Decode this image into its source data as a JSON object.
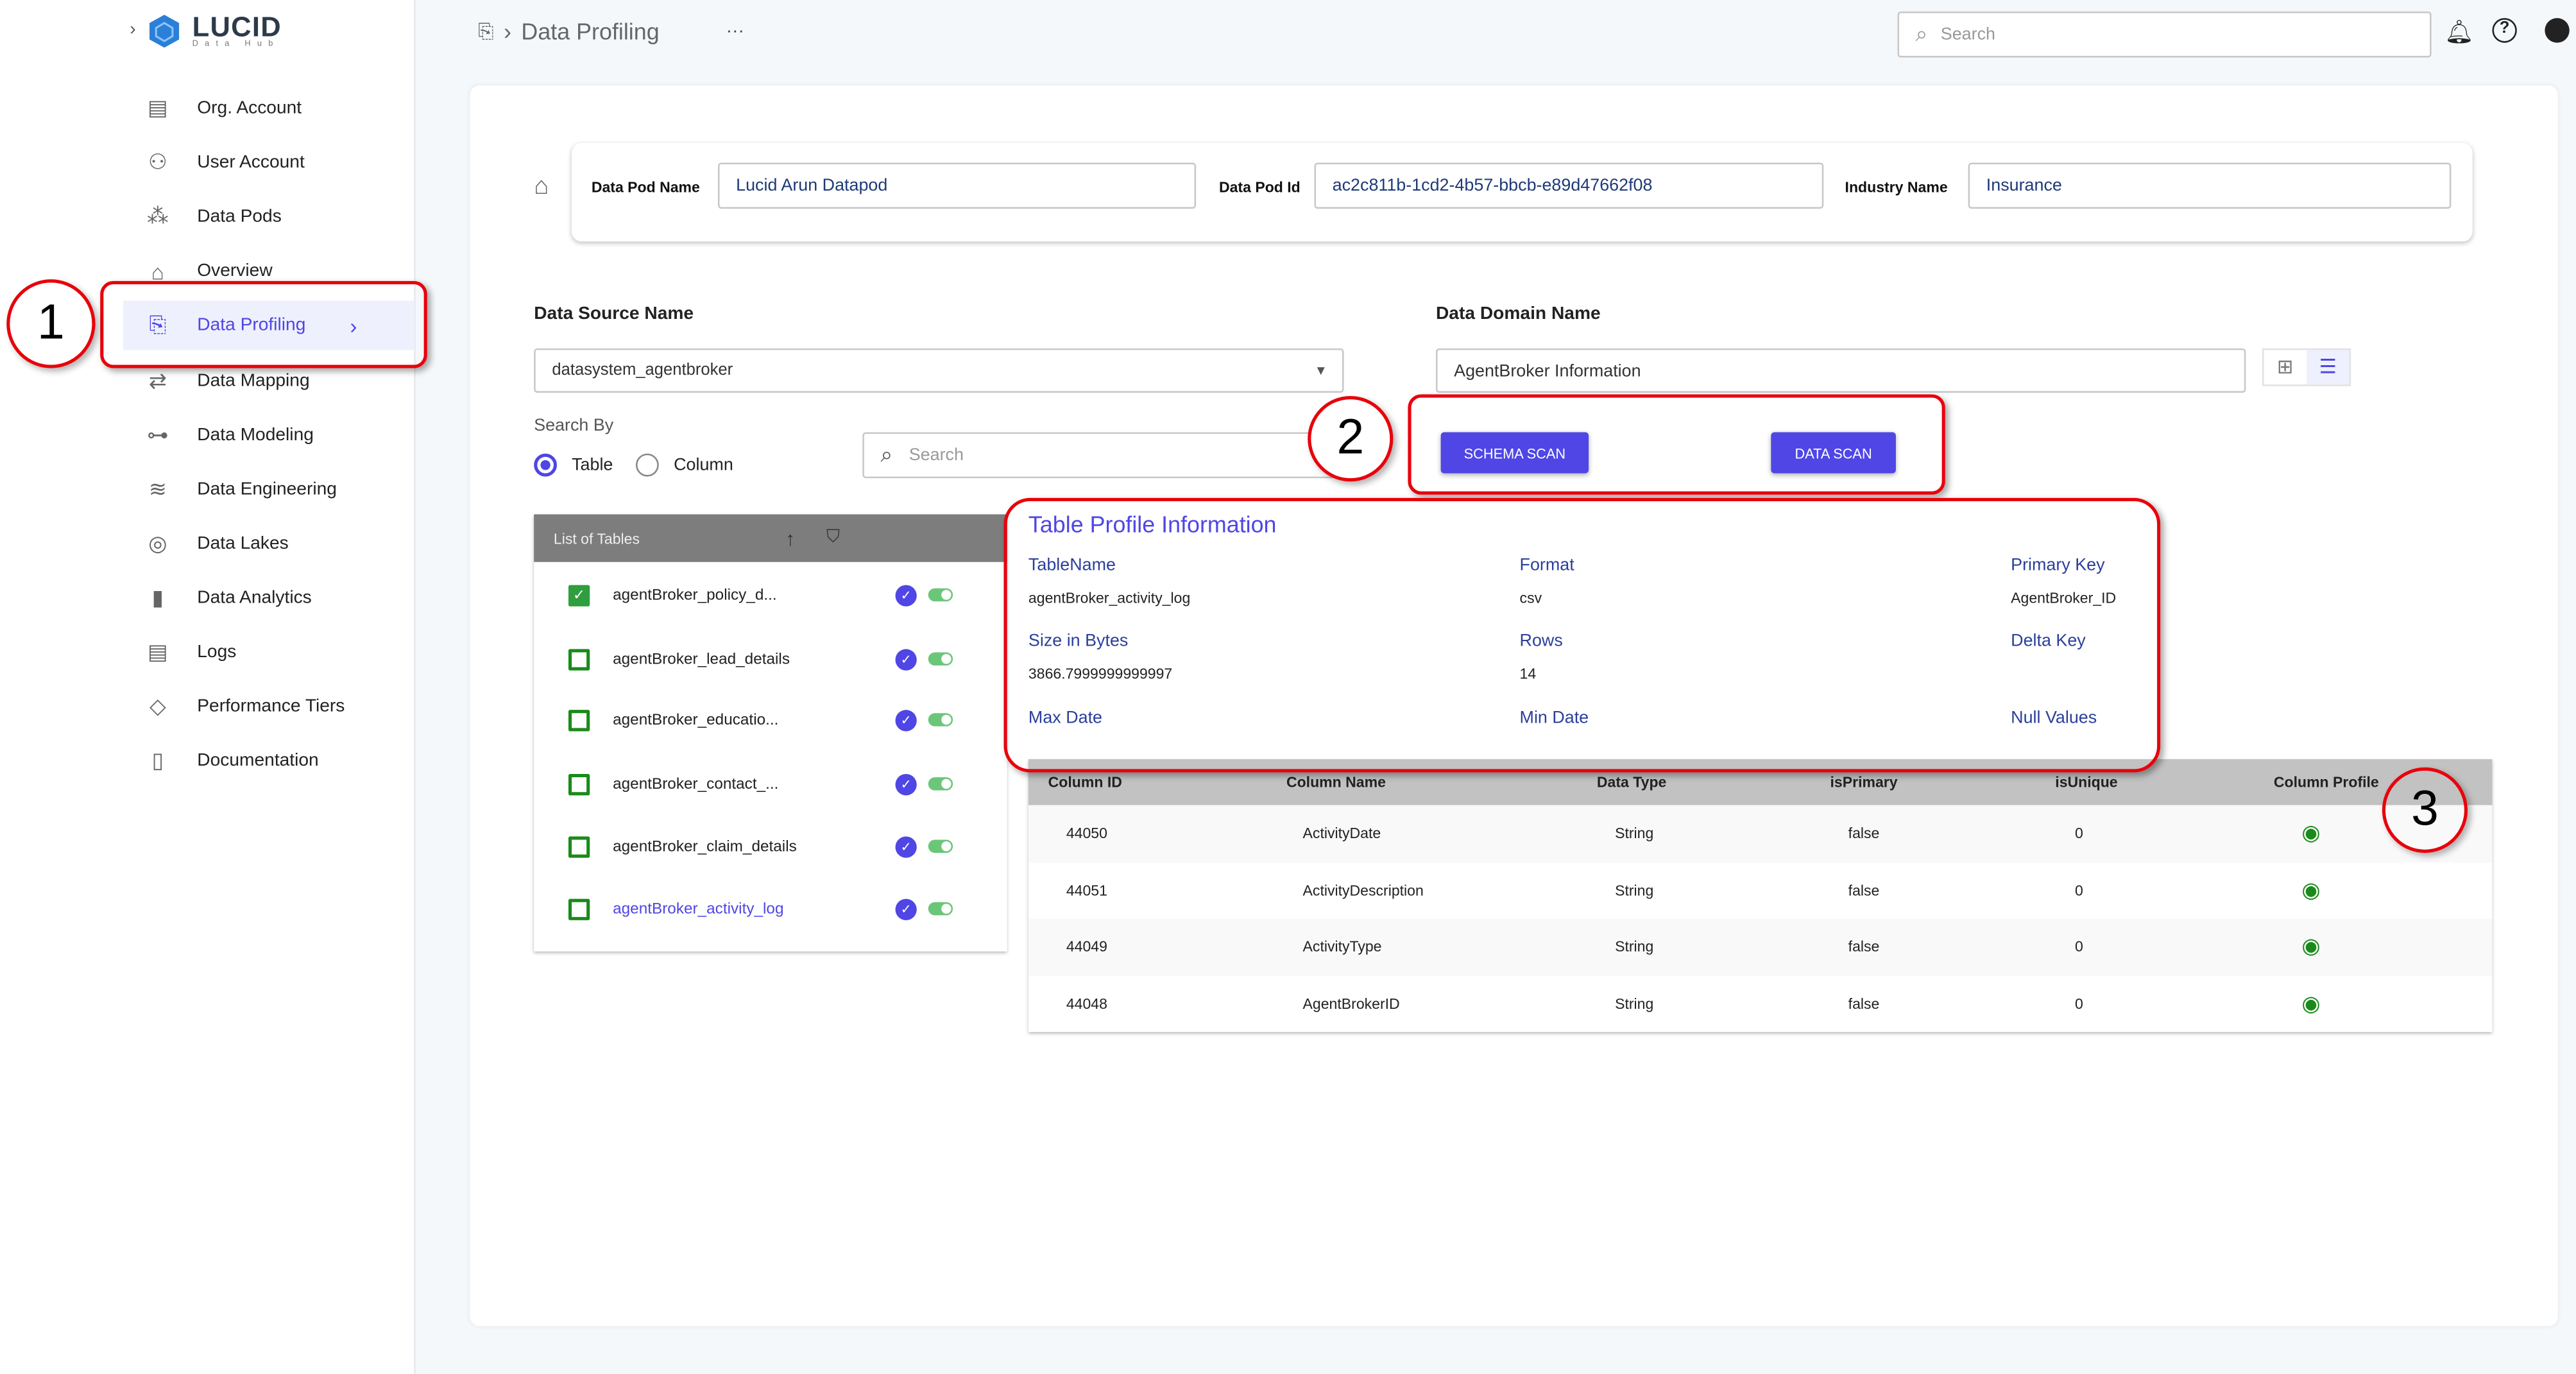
{
  "logo": {
    "name": "LUCID",
    "sub": "Data Hub"
  },
  "sidebar": {
    "items": [
      {
        "label": "Org. Account",
        "icon": "building-icon"
      },
      {
        "label": "User Account",
        "icon": "user-icon"
      },
      {
        "label": "Data Pods",
        "icon": "pods-icon"
      },
      {
        "label": "Overview",
        "icon": "home-icon"
      },
      {
        "label": "Data Profiling",
        "icon": "profiling-icon",
        "active": true
      },
      {
        "label": "Data Mapping",
        "icon": "mapping-arrows-icon"
      },
      {
        "label": "Data Modeling",
        "icon": "modeling-icon"
      },
      {
        "label": "Data Engineering",
        "icon": "engineering-icon"
      },
      {
        "label": "Data Lakes",
        "icon": "lakes-icon"
      },
      {
        "label": "Data Analytics",
        "icon": "bar-chart-icon"
      },
      {
        "label": "Logs",
        "icon": "logs-icon"
      },
      {
        "label": "Performance Tiers",
        "icon": "tag-icon"
      },
      {
        "label": "Documentation",
        "icon": "document-icon"
      }
    ]
  },
  "header": {
    "breadcrumb": "Data Profiling",
    "more": "···",
    "search_placeholder": "Search"
  },
  "pod": {
    "name_label": "Data Pod Name",
    "name": "Lucid Arun Datapod",
    "id_label": "Data Pod Id",
    "id": "ac2c811b-1cd2-4b57-bbcb-e89d47662f08",
    "industry_label": "Industry Name",
    "industry": "Insurance"
  },
  "source": {
    "label": "Data Source Name",
    "value": "datasystem_agentbroker"
  },
  "domain": {
    "label": "Data Domain Name",
    "value": "AgentBroker Information"
  },
  "search_by": {
    "label": "Search By",
    "options": [
      "Table",
      "Column"
    ],
    "selected": "Table",
    "placeholder": "Search"
  },
  "buttons": {
    "schema_scan": "SCHEMA SCAN",
    "data_scan": "DATA SCAN"
  },
  "tables": {
    "header": "List of Tables",
    "items": [
      {
        "name": "agentBroker_policy_d...",
        "checked": true
      },
      {
        "name": "agentBroker_lead_details",
        "checked": false
      },
      {
        "name": "agentBroker_educatio...",
        "checked": false
      },
      {
        "name": "agentBroker_contact_...",
        "checked": false
      },
      {
        "name": "agentBroker_claim_details",
        "checked": false
      },
      {
        "name": "agentBroker_activity_log",
        "checked": false,
        "selected": true
      }
    ]
  },
  "profile": {
    "title": "Table Profile Information",
    "fields": [
      {
        "label": "TableName",
        "value": "agentBroker_activity_log"
      },
      {
        "label": "Format",
        "value": "csv"
      },
      {
        "label": "Primary Key",
        "value": "AgentBroker_ID"
      },
      {
        "label": "Size in Bytes",
        "value": "3866.7999999999997"
      },
      {
        "label": "Rows",
        "value": "14"
      },
      {
        "label": "Delta Key",
        "value": ""
      },
      {
        "label": "Max Date",
        "value": ""
      },
      {
        "label": "Min Date",
        "value": ""
      },
      {
        "label": "Null Values",
        "value": ""
      }
    ]
  },
  "columns": {
    "headers": [
      "Column ID",
      "Column Name",
      "Data Type",
      "isPrimary",
      "isUnique",
      "Column Profile"
    ],
    "rows": [
      [
        "44050",
        "ActivityDate",
        "String",
        "false",
        "0"
      ],
      [
        "44051",
        "ActivityDescription",
        "String",
        "false",
        "0"
      ],
      [
        "44049",
        "ActivityType",
        "String",
        "false",
        "0"
      ],
      [
        "44048",
        "AgentBrokerID",
        "String",
        "false",
        "0"
      ]
    ]
  },
  "annotations": [
    "1",
    "2",
    "3"
  ],
  "colors": {
    "accent": "#4f46e5",
    "annotation": "#e8000b",
    "check_green": "#2e9e3e",
    "eye_green": "#1a8a1a"
  }
}
